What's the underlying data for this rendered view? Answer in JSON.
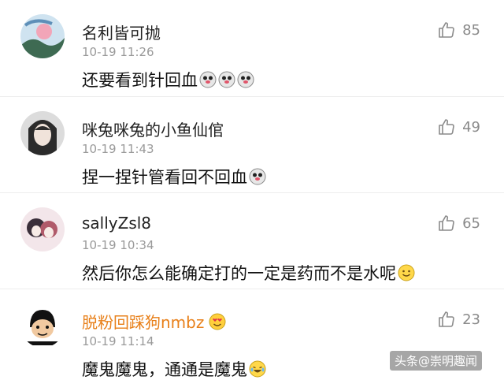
{
  "comments": [
    {
      "username": "名利皆可抛",
      "time": "10-19 11:26",
      "text": "还要看到针回血",
      "likes": "85",
      "emoji": "dog-face-emoji",
      "emoji_count": 3,
      "avatar": "landscape-avatar",
      "avatar_colors": [
        "#5e8fb8",
        "#f2a5b8",
        "#3e6a52"
      ]
    },
    {
      "username": "咪兔咪兔的小鱼仙倌",
      "time": "10-19 11:43",
      "text": "捏一捏针管看回不回血",
      "likes": "49",
      "emoji": "dog-face-emoji",
      "emoji_count": 1,
      "avatar": "portrait-avatar",
      "avatar_colors": [
        "#2b2b2b",
        "#f0e3da",
        "#dcdcdc"
      ]
    },
    {
      "username": "sallyZsl8",
      "time": "10-19 10:34",
      "text": "然后你怎么能确定打的一定是药而不是水呢",
      "likes": "65",
      "emoji": "smile-emoji",
      "emoji_count": 1,
      "avatar": "couple-avatar",
      "avatar_colors": [
        "#3a2f3a",
        "#f3e6ea",
        "#b05a6a"
      ]
    },
    {
      "username": "脱粉回踩狗nmbz",
      "time": "10-19 11:14",
      "text": "魔鬼魔鬼，通通是魔鬼",
      "likes": "23",
      "emoji": "laugh-cry-emoji",
      "emoji_count": 1,
      "badge": "heart-eyes-emoji",
      "avatar": "meme-avatar",
      "avatar_colors": [
        "#ffffff",
        "#111111",
        "#f1c9a0"
      ]
    }
  ],
  "watermark": "头条@崇明趣闻",
  "colors": {
    "vip_username": "#e8801a",
    "timestamp": "#9a9a9a",
    "like_count": "#8a8a8a"
  }
}
